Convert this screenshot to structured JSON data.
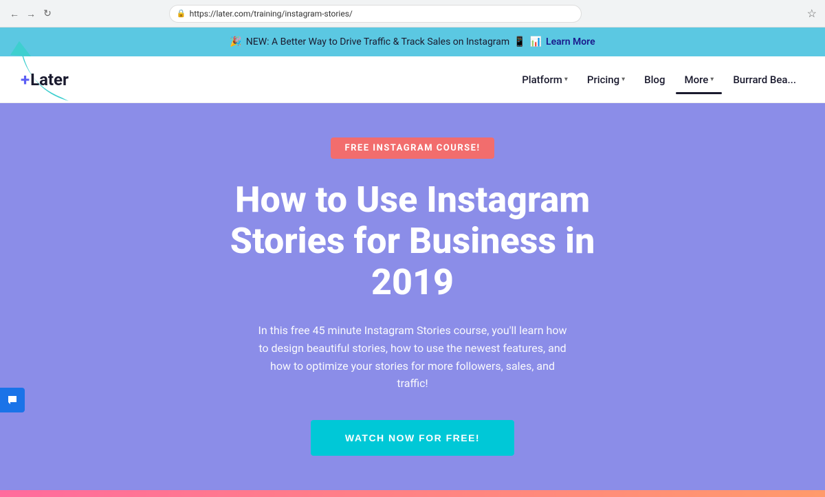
{
  "browser": {
    "url": "https://later.com/training/instagram-stories/",
    "back_label": "←",
    "forward_label": "→",
    "refresh_label": "↻"
  },
  "announcement": {
    "emoji": "🎉",
    "text": "NEW: A Better Way to Drive Traffic & Track Sales on Instagram",
    "emoji2": "📱",
    "emoji3": "📊",
    "link_text": "Learn More"
  },
  "nav": {
    "logo_symbol": "+",
    "logo_text": "Later",
    "items": [
      {
        "label": "Platform",
        "has_chevron": true,
        "active": false
      },
      {
        "label": "Pricing",
        "has_chevron": true,
        "active": false
      },
      {
        "label": "Blog",
        "has_chevron": false,
        "active": false
      },
      {
        "label": "More",
        "has_chevron": true,
        "active": true
      }
    ],
    "account_label": "Burrard Bea..."
  },
  "hero": {
    "badge": "FREE INSTAGRAM COURSE!",
    "title": "How to Use Instagram Stories for Business in 2019",
    "description": "In this free 45 minute Instagram Stories course, you'll learn how to design beautiful stories, how to use the newest features, and how to optimize your stories for more followers, sales, and traffic!",
    "cta": "WATCH NOW FOR FREE!"
  }
}
